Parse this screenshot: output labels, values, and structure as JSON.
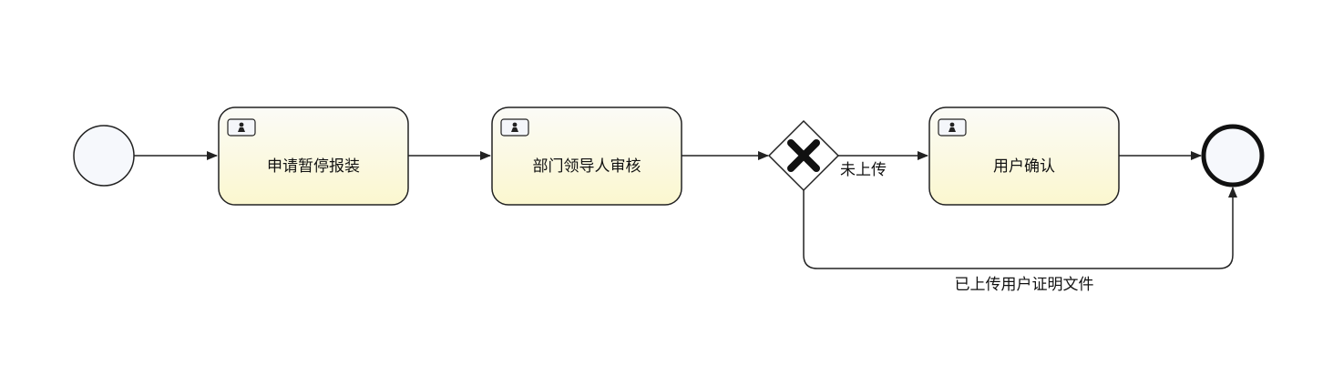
{
  "diagram": {
    "colors": {
      "task_fill_top": "#fbfbf7",
      "task_fill_bottom": "#fbf7cf",
      "event_fill": "#f6f8fc",
      "stroke": "#222222"
    },
    "start_event": {
      "icon": "start-event-circle"
    },
    "end_event": {
      "icon": "end-event-circle"
    },
    "tasks": [
      {
        "label": "申请暂停报装",
        "icon": "user-task-icon"
      },
      {
        "label": "部门领导人审核",
        "icon": "user-task-icon"
      },
      {
        "label": "用户确认",
        "icon": "user-task-icon"
      }
    ],
    "gateway": {
      "type": "exclusive",
      "icon": "x-icon"
    },
    "flows": {
      "not_uploaded": "未上传",
      "uploaded": "已上传用户证明文件"
    }
  }
}
